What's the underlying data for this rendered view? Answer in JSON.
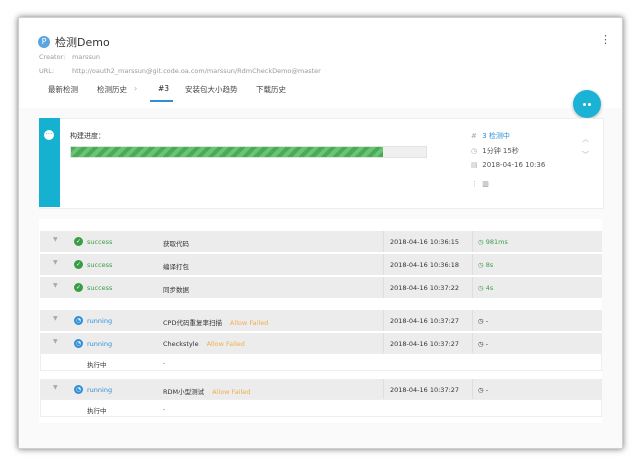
{
  "app": {
    "logo_letter": "P",
    "title": "检测Demo",
    "creator_label": "Creator:",
    "creator": "marssun",
    "url_label": "URL:",
    "url": "http://oauth2_marssun@git.code.oa.com/marssun/RdmCheckDemo@master",
    "menu_icon": "kebab-vertical-icon"
  },
  "tabs": [
    {
      "label": "最新检测"
    },
    {
      "label": "检测历史"
    },
    {
      "label": "#3",
      "active": true
    },
    {
      "label": "安装包大小趋势"
    },
    {
      "label": "下载历史"
    }
  ],
  "build": {
    "progress_label": "构建进度：",
    "progress": 0.88,
    "status": "3 检测中",
    "duration": "1分钟 15秒",
    "date": "2018-04-16 10:36",
    "colors": {
      "accent": "#16b1d1",
      "progress": "#47ac52",
      "link": "#2d8fd5"
    }
  },
  "steps": [
    {
      "status": "success",
      "name": "获取代码",
      "allow_failed": "",
      "time": "2018-04-16 10:36:15",
      "duration": "981ms"
    },
    {
      "status": "success",
      "name": "编译打包",
      "allow_failed": "",
      "time": "2018-04-16 10:36:18",
      "duration": "8s"
    },
    {
      "status": "success",
      "name": "同步数据",
      "allow_failed": "",
      "time": "2018-04-16 10:37:22",
      "duration": "4s"
    },
    {
      "status": "running",
      "name": "CPD代码重复率扫描",
      "allow_failed": "Allow Failed",
      "time": "2018-04-16 10:37:27",
      "duration": "-"
    },
    {
      "status": "running",
      "name": "Checkstyle",
      "allow_failed": "Allow Failed",
      "time": "2018-04-16 10:37:27",
      "duration": "-",
      "sub": {
        "label": "执行中",
        "value": "-"
      }
    },
    {
      "status": "running",
      "name": "RDM小型测试",
      "allow_failed": "Allow Failed",
      "time": "2018-04-16 10:37:27",
      "duration": "-",
      "sub": {
        "label": "执行中",
        "value": "-"
      }
    }
  ]
}
